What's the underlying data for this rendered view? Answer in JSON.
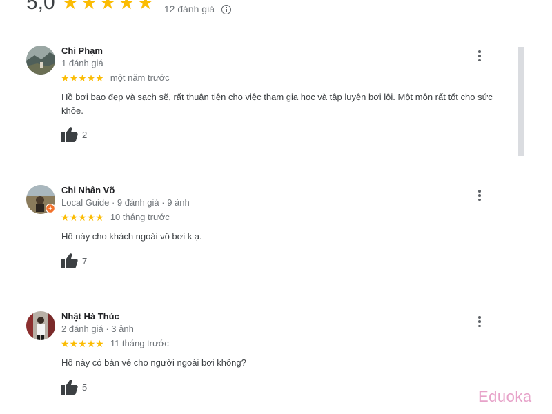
{
  "summary": {
    "rating": "5,0",
    "stars": 5,
    "count_label": "12 đánh giá",
    "info_icon": "info-icon"
  },
  "reviews": [
    {
      "name": "Chi Phạm",
      "meta": "1 đánh giá",
      "stars": 5,
      "when": "một năm trước",
      "text": "Hồ bơi bao đẹp và sạch sẽ, rất thuận tiện cho việc tham gia học và tập luyện bơi lội. Một môn rất tốt cho sức khỏe.",
      "likes": "2"
    },
    {
      "name": "Chi Nhân Võ",
      "meta": "Local Guide · 9 đánh giá · 9 ảnh",
      "stars": 5,
      "when": "10 tháng trước",
      "text": "Hồ này cho khách ngoài vô bơi k ạ.",
      "likes": "7"
    },
    {
      "name": "Nhật Hà Thúc",
      "meta": "2 đánh giá · 3 ảnh",
      "stars": 5,
      "when": "11 tháng trước",
      "text": "Hồ này có bán vé cho người ngoài bơi không?",
      "likes": "5"
    }
  ],
  "watermark": "Eduoka",
  "colors": {
    "star": "#fbbc04",
    "muted": "#70757a",
    "watermark": "#e7a2c9"
  }
}
